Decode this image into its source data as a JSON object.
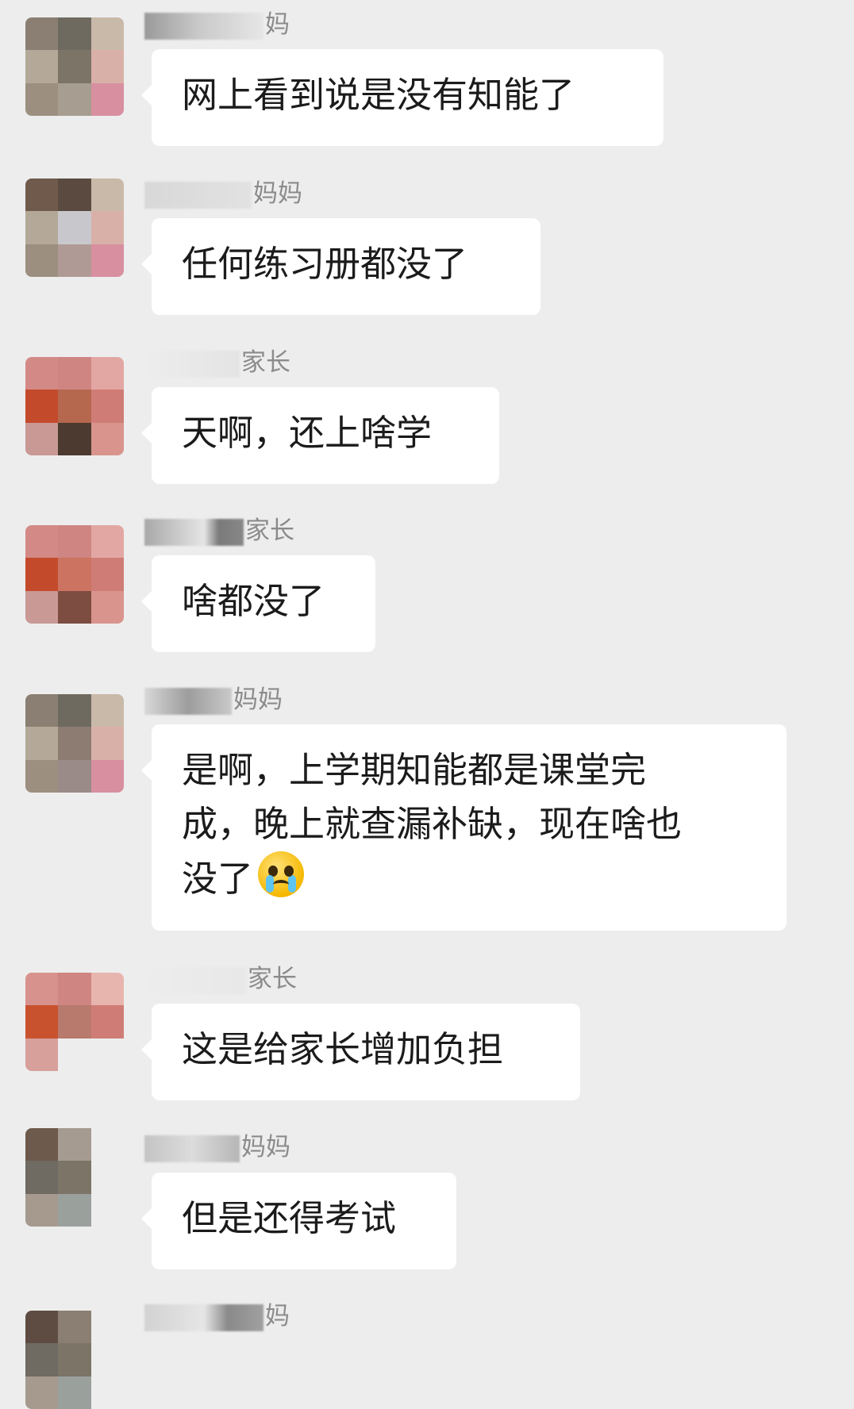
{
  "messages": [
    {
      "sender": "妈",
      "text": [
        "网上看到说是没有知能了"
      ]
    },
    {
      "sender": "妈妈",
      "text": [
        "任何练习册都没了"
      ]
    },
    {
      "sender": "家长",
      "text": [
        "天啊，还上啥学"
      ]
    },
    {
      "sender": "家长",
      "text": [
        "啥都没了"
      ]
    },
    {
      "sender": "妈妈",
      "text": [
        "是啊，上学期知能都是课堂完",
        "成，晚上就查漏补缺，现在啥也",
        "没了"
      ],
      "emoji": "crying-face-icon"
    },
    {
      "sender": "家长",
      "text": [
        "这是给家长增加负担"
      ]
    },
    {
      "sender": "妈妈",
      "text": [
        "但是还得考试"
      ]
    },
    {
      "sender": "妈",
      "text": []
    }
  ],
  "colors": {
    "background": "#ededed",
    "bubble": "#ffffff",
    "name_text": "#8b8b8b",
    "message_text": "#1b1b1b"
  }
}
